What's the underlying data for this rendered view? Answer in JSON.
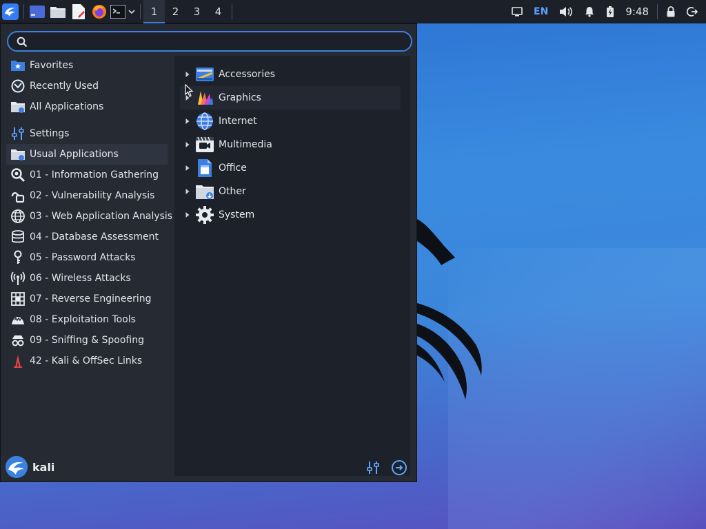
{
  "panel": {
    "workspaces": [
      "1",
      "2",
      "3",
      "4"
    ],
    "active_workspace": 0,
    "language": "EN",
    "clock": "9:48"
  },
  "menu": {
    "search": {
      "value": "",
      "placeholder": ""
    },
    "sidebar": [
      {
        "label": "Favorites",
        "icon": "star-folder-icon"
      },
      {
        "label": "Recently Used",
        "icon": "recent-icon"
      },
      {
        "label": "All Applications",
        "icon": "applications-folder-icon"
      },
      {
        "label": "Settings",
        "icon": "settings-sliders-icon"
      },
      {
        "label": "Usual Applications",
        "icon": "usual-folder-icon"
      },
      {
        "label": "01 - Information Gathering",
        "icon": "magnifier-icon"
      },
      {
        "label": "02 - Vulnerability Analysis",
        "icon": "vulnerability-icon"
      },
      {
        "label": "03 - Web Application Analysis",
        "icon": "globe-icon"
      },
      {
        "label": "04 - Database Assessment",
        "icon": "database-icon"
      },
      {
        "label": "05 - Password Attacks",
        "icon": "key-icon"
      },
      {
        "label": "06 - Wireless Attacks",
        "icon": "wireless-icon"
      },
      {
        "label": "07 - Reverse Engineering",
        "icon": "grid-icon"
      },
      {
        "label": "08 - Exploitation Tools",
        "icon": "exploit-icon"
      },
      {
        "label": "09 - Sniffing & Spoofing",
        "icon": "spy-icon"
      },
      {
        "label": "42 - Kali & OffSec Links",
        "icon": "offsec-icon"
      }
    ],
    "categories": [
      {
        "label": "Accessories",
        "icon": "accessories-icon"
      },
      {
        "label": "Graphics",
        "icon": "graphics-icon"
      },
      {
        "label": "Internet",
        "icon": "internet-icon"
      },
      {
        "label": "Multimedia",
        "icon": "multimedia-icon"
      },
      {
        "label": "Office",
        "icon": "office-icon"
      },
      {
        "label": "Other",
        "icon": "other-icon"
      },
      {
        "label": "System",
        "icon": "system-gear-icon"
      }
    ],
    "user": {
      "name": "kali"
    }
  },
  "colors": {
    "accent": "#3e7ee0",
    "panel": "#1c2129",
    "menu": "#252a33"
  }
}
